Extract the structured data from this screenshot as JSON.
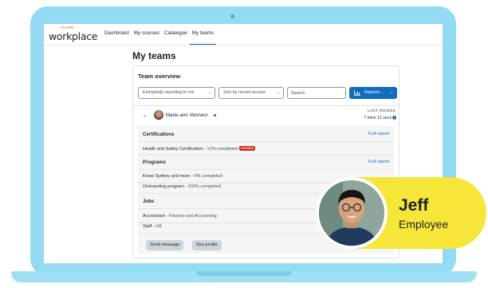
{
  "brand": {
    "small": "moodle",
    "main": "workplace",
    "accent": "#f98012",
    "primary": "#0f6cbf"
  },
  "nav": {
    "items": [
      "Dashboard",
      "My courses",
      "Catalogue",
      "My teams"
    ],
    "active": "My teams"
  },
  "page": {
    "title": "My teams"
  },
  "card": {
    "title": "Team overview",
    "filter1": "Everybody reporting to me",
    "filter2": "Sort by recent access",
    "search_placeholder": "Search",
    "reports_label": "Reports..."
  },
  "member": {
    "name": "Marie-ann Venneur",
    "last_access_label": "LAST ACCESS",
    "last_access_value": "7 mins 11 secs"
  },
  "details": {
    "certifications": {
      "title": "Certifications",
      "link": "Full report",
      "items": [
        {
          "name": "Health and Safety Certification",
          "status": " - 12% completed",
          "badge": "Overdue"
        }
      ]
    },
    "programs": {
      "title": "Programs",
      "link": "Full report",
      "items": [
        {
          "name": "Know Sydney and more",
          "status": " - 0% completed"
        },
        {
          "name": "Onboarding program",
          "status": " - 100% completed"
        }
      ]
    },
    "jobs": {
      "title": "Jobs",
      "items": [
        {
          "name": "Accountant",
          "org": " - Finance and Accounting"
        },
        {
          "name": "Staff",
          "org": " - UK"
        }
      ]
    },
    "buttons": {
      "send_message": "Send message",
      "see_profile": "See profile"
    }
  },
  "badge": {
    "name": "Jeff",
    "role": "Employee",
    "color": "#f7e63a"
  }
}
